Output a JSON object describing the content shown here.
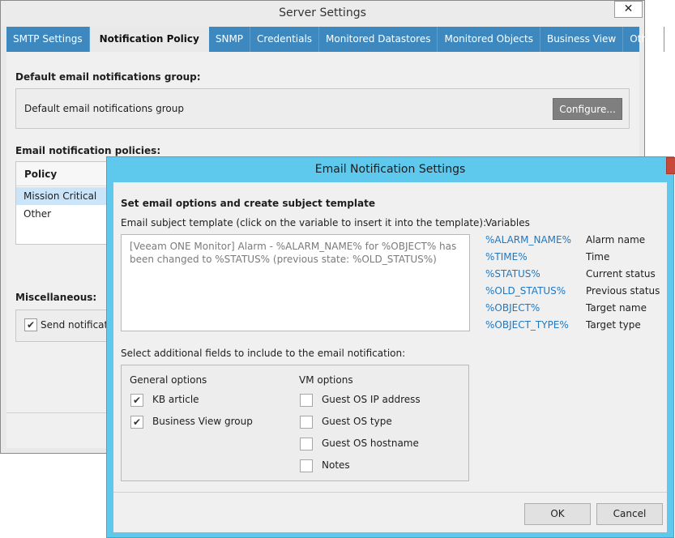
{
  "server_window": {
    "title": "Server Settings",
    "close_glyph": "✕",
    "tabs": [
      {
        "label": "SMTP Settings",
        "active": false
      },
      {
        "label": "Notification Policy",
        "active": true
      },
      {
        "label": "SNMP",
        "active": false
      },
      {
        "label": "Credentials",
        "active": false
      },
      {
        "label": "Monitored Datastores",
        "active": false
      },
      {
        "label": "Monitored Objects",
        "active": false
      },
      {
        "label": "Business View",
        "active": false
      },
      {
        "label": "Other",
        "active": false
      }
    ],
    "default_group_heading": "Default email notifications group:",
    "default_group_label": "Default email notifications group",
    "configure_button": "Configure...",
    "policies_heading": "Email notification policies:",
    "policy_column": "Policy",
    "policies": [
      "Mission Critical",
      "Other"
    ],
    "misc_heading": "Miscellaneous:",
    "send_label": "Send notificatio"
  },
  "email_dialog": {
    "title": "Email Notification Settings",
    "close_glyph": "✕",
    "heading": "Set email options and create subject template",
    "subject_label": "Email subject template (click on the variable to insert it into the template):",
    "subject_value": "[Veeam ONE Monitor] Alarm - %ALARM_NAME% for %OBJECT% has been changed to %STATUS% (previous state: %OLD_STATUS%)",
    "variables_header": "Variables",
    "variables": [
      {
        "name": "%ALARM_NAME%",
        "desc": "Alarm name"
      },
      {
        "name": "%TIME%",
        "desc": "Time"
      },
      {
        "name": "%STATUS%",
        "desc": "Current status"
      },
      {
        "name": "%OLD_STATUS%",
        "desc": "Previous status"
      },
      {
        "name": "%OBJECT%",
        "desc": "Target name"
      },
      {
        "name": "%OBJECT_TYPE%",
        "desc": "Target type"
      }
    ],
    "fields_label": "Select additional fields to include to the email notification:",
    "general_title": "General options",
    "general_options": [
      {
        "label": "KB article",
        "checked": true
      },
      {
        "label": "Business View group",
        "checked": true
      }
    ],
    "vm_title": "VM options",
    "vm_options": [
      {
        "label": "Guest OS IP address",
        "checked": false
      },
      {
        "label": "Guest OS type",
        "checked": false
      },
      {
        "label": "Guest OS hostname",
        "checked": false
      },
      {
        "label": "Notes",
        "checked": false
      }
    ],
    "ok_button": "OK",
    "cancel_button": "Cancel",
    "check_glyph": "✔"
  },
  "colors": {
    "tab_bar": "#3c88bf",
    "dialog_titlebar": "#5fc9ed",
    "close_button": "#c7493a",
    "variable_link": "#1f78c1",
    "selected_row": "#cce4f7"
  }
}
